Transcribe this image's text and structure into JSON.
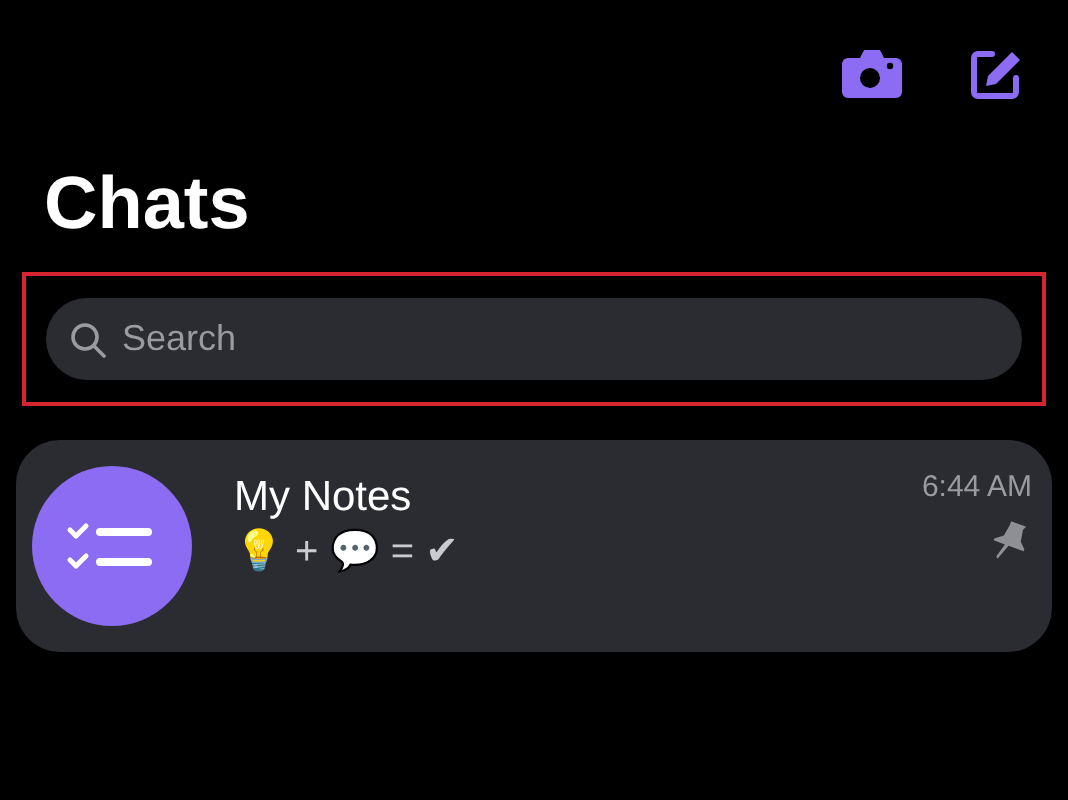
{
  "header": {
    "title": "Chats"
  },
  "search": {
    "placeholder": "Search",
    "highlighted": true
  },
  "chats": [
    {
      "name": "My Notes",
      "preview": "💡 + 💬 = ✔",
      "time": "6:44 AM",
      "pinned": true
    }
  ]
}
